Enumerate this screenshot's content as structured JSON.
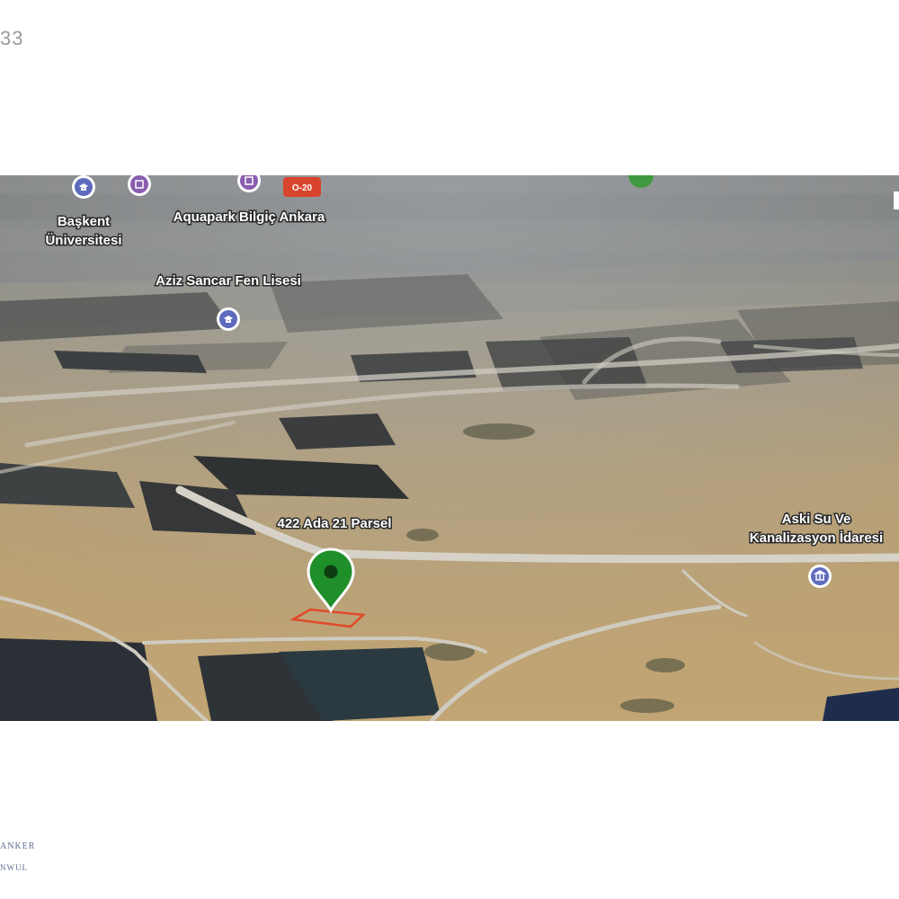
{
  "page": {
    "corner_number": "33",
    "watermark_line1": "ANKER",
    "watermark_line2": "NWUL"
  },
  "map": {
    "labels": {
      "baskent_line1": "Başkent",
      "baskent_line2": "Üniversitesi",
      "aquapark": "Aquapark Bilgiç Ankara",
      "aziz_sancar": "Aziz Sancar Fen Lisesi",
      "parcel": "422 Ada 21 Parsel",
      "aski_line1": "Aski Su Ve",
      "aski_line2": "Kanalizasyon İdaresi"
    },
    "road_shield": "O-20",
    "pin_color": "#1f8f2a",
    "parcel_outline_color": "#e0492a",
    "poi_icons": [
      "school-icon",
      "attraction-icon",
      "attraction-icon",
      "school-icon",
      "government-building-icon"
    ]
  }
}
